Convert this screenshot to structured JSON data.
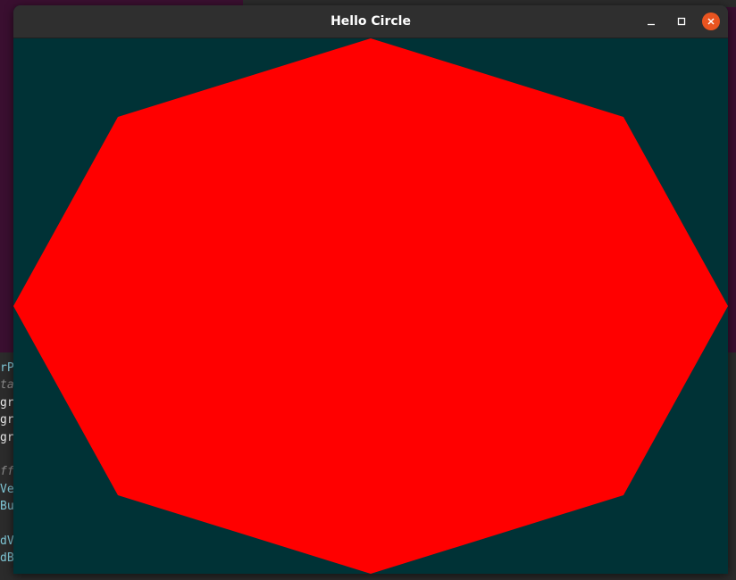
{
  "window": {
    "title": "Hello Circle",
    "clear_color": "#003236",
    "shape_color": "#ff0000"
  },
  "titlebar": {
    "minimize_icon": "minimize-icon",
    "maximize_icon": "maximize-icon",
    "close_icon": "close-icon",
    "close_color": "#e95420"
  },
  "canvas": {
    "shape": "octagon",
    "sides": 8
  },
  "background_code": {
    "lines": [
      {
        "text": "rP",
        "style": "c-cyan"
      },
      {
        "text": "ta",
        "style": "c-gray"
      },
      {
        "text": "gr",
        "style": "c-white"
      },
      {
        "text": "gr",
        "style": "c-white"
      },
      {
        "text": "gr",
        "style": "c-white"
      },
      {
        "text": "",
        "style": "c-white"
      },
      {
        "text": "ff",
        "style": "c-gray"
      },
      {
        "text": "Ve",
        "style": "c-cyan"
      },
      {
        "text": "Bu",
        "style": "c-cyan"
      },
      {
        "text": "",
        "style": "c-white"
      },
      {
        "text": "dV",
        "style": "c-cyan"
      },
      {
        "text": "dB",
        "style": "c-cyan"
      }
    ]
  }
}
